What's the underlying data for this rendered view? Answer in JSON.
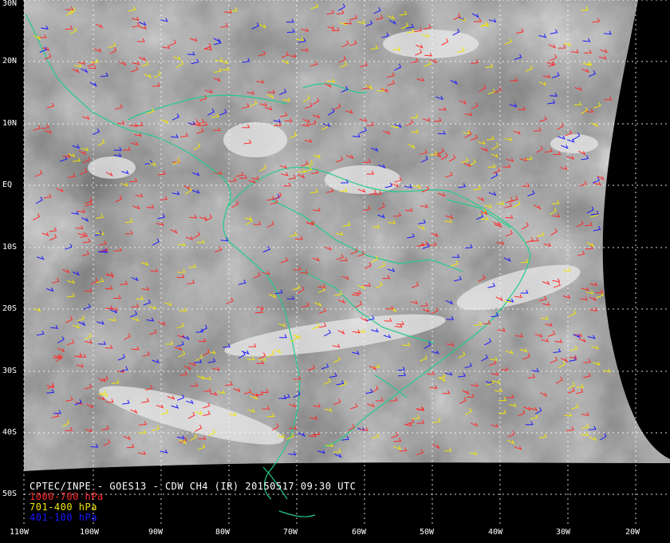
{
  "caption": {
    "title": "CPTEC/INPE - GOES13 - CDW CH4 (IR) 20150517 09:30 UTC",
    "legend": [
      {
        "label": "1000-700 hPa",
        "color": "#ff2a2a"
      },
      {
        "label": "701-400 hPa",
        "color": "#f2e600"
      },
      {
        "label": "401-100 hPa",
        "color": "#1a1aff"
      }
    ]
  },
  "lat_labels": [
    "30N",
    "20N",
    "10N",
    "EQ",
    "10S",
    "20S",
    "30S",
    "40S",
    "50S"
  ],
  "lon_labels": [
    "110W",
    "100W",
    "90W",
    "80W",
    "70W",
    "60W",
    "50W",
    "40W",
    "30W",
    "20W"
  ],
  "colors": {
    "coastline": "#22cc88",
    "grid": "#ffffff",
    "background": "#000000"
  }
}
